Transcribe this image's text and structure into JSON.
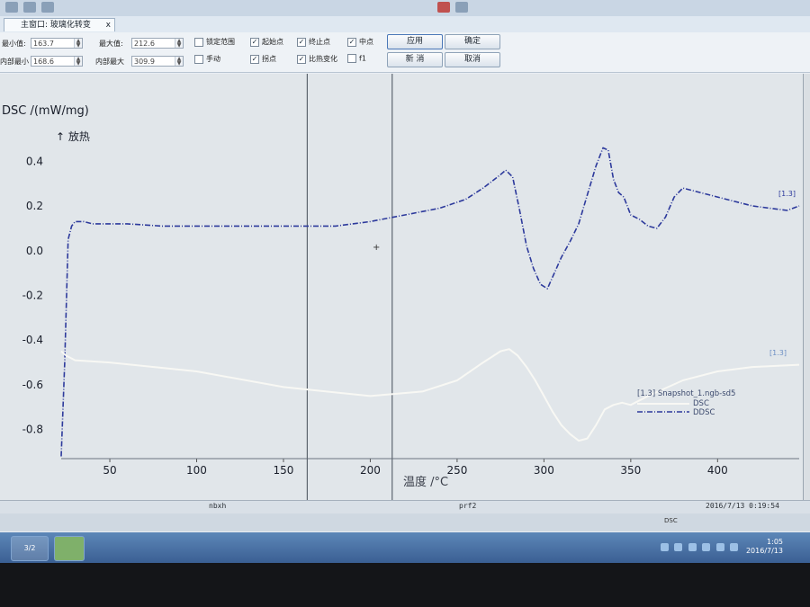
{
  "tab": {
    "title": "主窗口: 玻璃化转变",
    "close_label": "x"
  },
  "controls": {
    "min_label": "最小值:",
    "min_value": "163.7",
    "max_label": "最大值:",
    "max_value": "212.6",
    "inner_min_label": "内部最小",
    "inner_min_value": "168.6",
    "inner_max_label": "内部最大",
    "inner_max_value": "309.9",
    "checkboxes": [
      {
        "label": "锁定范围",
        "checked": false
      },
      {
        "label": "手动",
        "checked": false
      },
      {
        "label": "起始点",
        "checked": true
      },
      {
        "label": "拐点",
        "checked": true
      },
      {
        "label": "终止点",
        "checked": true
      },
      {
        "label": "比热变化",
        "checked": true
      },
      {
        "label": "中点",
        "checked": true
      },
      {
        "label": "f1",
        "checked": false
      }
    ],
    "check_mark": "✓",
    "apply_label": "应用",
    "confirm_label": "确定",
    "new_label": "新 消",
    "cancel_label": "取消"
  },
  "plot": {
    "ylabel": "DSC /(mW/mg)",
    "exo_label": "↑ 放热",
    "xlabel": "温度 /°C",
    "legend_title": "[1.3] Snapshot_1.ngb-sd5",
    "series_dsc_name": "DSC",
    "series_ddsc_name": "DDSC",
    "curve_tag_top": "[1.3]",
    "curve_tag_bottom": "[1.3]"
  },
  "chart_data": {
    "type": "line",
    "xlabel": "温度 /°C",
    "ylabel": "DSC /(mW/mg)",
    "xlim": [
      22,
      447
    ],
    "ylim": [
      -0.93,
      0.55
    ],
    "x_ticks": [
      50,
      100,
      150,
      200,
      250,
      300,
      350,
      400
    ],
    "y_ticks": [
      0.4,
      0.2,
      0.0,
      -0.2,
      -0.4,
      -0.6,
      -0.8
    ],
    "y_tick_labels": [
      "0.4",
      "0.2",
      "0.0",
      "-0.2",
      "-0.4",
      "-0.6",
      "-0.8"
    ],
    "vertical_markers": [
      163.7,
      212.6
    ],
    "series": [
      {
        "name": "DSC",
        "color": "#2d3a9c",
        "style": "dash-dot",
        "x": [
          22,
          24,
          26,
          28,
          30,
          35,
          40,
          60,
          80,
          100,
          120,
          140,
          160,
          180,
          200,
          220,
          240,
          255,
          265,
          270,
          275,
          278,
          282,
          286,
          290,
          294,
          298,
          302,
          306,
          310,
          315,
          320,
          325,
          330,
          334,
          337,
          340,
          343,
          346,
          350,
          355,
          360,
          365,
          370,
          375,
          380,
          385,
          400,
          420,
          440,
          447
        ],
        "y": [
          -0.92,
          -0.5,
          0.05,
          0.11,
          0.13,
          0.13,
          0.12,
          0.12,
          0.11,
          0.11,
          0.11,
          0.11,
          0.11,
          0.11,
          0.13,
          0.16,
          0.19,
          0.23,
          0.28,
          0.31,
          0.34,
          0.36,
          0.33,
          0.18,
          0.02,
          -0.08,
          -0.15,
          -0.17,
          -0.1,
          -0.03,
          0.04,
          0.12,
          0.25,
          0.38,
          0.46,
          0.45,
          0.32,
          0.26,
          0.24,
          0.16,
          0.14,
          0.11,
          0.1,
          0.15,
          0.24,
          0.28,
          0.27,
          0.24,
          0.2,
          0.18,
          0.2
        ]
      },
      {
        "name": "DDSC",
        "color": "#f8f8f4",
        "style": "solid",
        "x": [
          22,
          25,
          30,
          50,
          100,
          150,
          200,
          230,
          250,
          265,
          275,
          280,
          285,
          290,
          295,
          300,
          305,
          310,
          315,
          320,
          325,
          330,
          335,
          340,
          345,
          350,
          360,
          380,
          400,
          420,
          447
        ],
        "y": [
          -0.45,
          -0.47,
          -0.49,
          -0.5,
          -0.54,
          -0.61,
          -0.65,
          -0.63,
          -0.58,
          -0.5,
          -0.45,
          -0.44,
          -0.47,
          -0.52,
          -0.58,
          -0.65,
          -0.72,
          -0.78,
          -0.82,
          -0.85,
          -0.84,
          -0.78,
          -0.71,
          -0.69,
          -0.68,
          -0.69,
          -0.65,
          -0.58,
          -0.54,
          -0.52,
          -0.51
        ]
      }
    ]
  },
  "status": {
    "left": "nbxh",
    "center": "prf2",
    "right": "2016/7/13 0:19:54"
  },
  "strip2": {
    "center": "DSC"
  },
  "taskbar": {
    "btn1": "3/2",
    "clock_time": "1:05",
    "clock_date": "2016/7/13"
  }
}
